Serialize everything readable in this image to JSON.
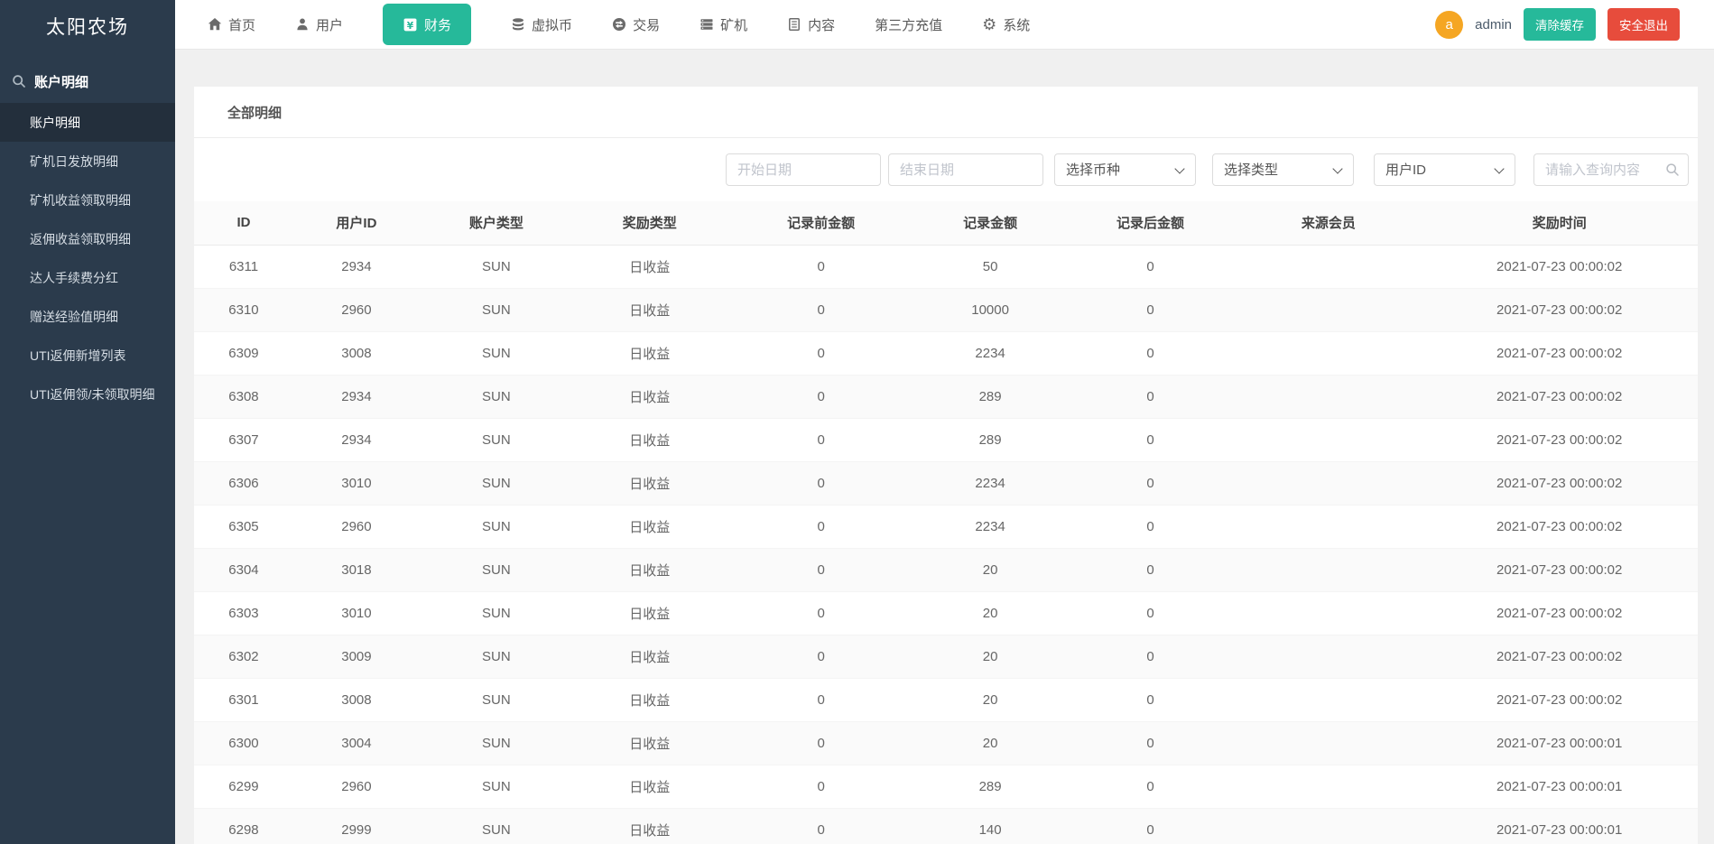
{
  "colors": {
    "green": "#26b99a",
    "red": "#e74c3c",
    "orange": "#f5a623",
    "sidebar_bg": "#2b3b4c"
  },
  "app": {
    "title": "太阳农场"
  },
  "topnav": {
    "items": [
      {
        "label": "首页",
        "icon": "home-icon"
      },
      {
        "label": "用户",
        "icon": "user-icon"
      },
      {
        "label": "财务",
        "icon": "finance-icon",
        "active": true
      },
      {
        "label": "虚拟币",
        "icon": "coins-icon"
      },
      {
        "label": "交易",
        "icon": "exchange-icon"
      },
      {
        "label": "矿机",
        "icon": "server-icon"
      },
      {
        "label": "内容",
        "icon": "content-icon"
      },
      {
        "label": "第三方充值",
        "icon": ""
      },
      {
        "label": "系统",
        "icon": "gear-icon"
      }
    ],
    "user": {
      "avatar_letter": "a",
      "name": "admin"
    },
    "clear_cache_label": "清除缓存",
    "logout_label": "安全退出"
  },
  "sidebar": {
    "section_title": "账户明细",
    "items": [
      {
        "label": "账户明细",
        "active": true
      },
      {
        "label": "矿机日发放明细"
      },
      {
        "label": "矿机收益领取明细"
      },
      {
        "label": "返佣收益领取明细"
      },
      {
        "label": "达人手续费分红"
      },
      {
        "label": "赠送经验值明细"
      },
      {
        "label": "UTI返佣新增列表"
      },
      {
        "label": "UTI返佣领/未领取明细"
      }
    ]
  },
  "panel": {
    "tab_label": "全部明细",
    "filters": {
      "start_date_placeholder": "开始日期",
      "end_date_placeholder": "结束日期",
      "coin_select_value": "选择币种",
      "type_select_value": "选择类型",
      "field_select_value": "用户ID",
      "search_placeholder": "请输入查询内容"
    },
    "table": {
      "columns": [
        "ID",
        "用户ID",
        "账户类型",
        "奖励类型",
        "记录前金额",
        "记录金额",
        "记录后金额",
        "来源会员",
        "奖励时间"
      ],
      "rows": [
        [
          "6311",
          "2934",
          "SUN",
          "日收益",
          "0",
          "50",
          "0",
          "",
          "2021-07-23 00:00:02"
        ],
        [
          "6310",
          "2960",
          "SUN",
          "日收益",
          "0",
          "10000",
          "0",
          "",
          "2021-07-23 00:00:02"
        ],
        [
          "6309",
          "3008",
          "SUN",
          "日收益",
          "0",
          "2234",
          "0",
          "",
          "2021-07-23 00:00:02"
        ],
        [
          "6308",
          "2934",
          "SUN",
          "日收益",
          "0",
          "289",
          "0",
          "",
          "2021-07-23 00:00:02"
        ],
        [
          "6307",
          "2934",
          "SUN",
          "日收益",
          "0",
          "289",
          "0",
          "",
          "2021-07-23 00:00:02"
        ],
        [
          "6306",
          "3010",
          "SUN",
          "日收益",
          "0",
          "2234",
          "0",
          "",
          "2021-07-23 00:00:02"
        ],
        [
          "6305",
          "2960",
          "SUN",
          "日收益",
          "0",
          "2234",
          "0",
          "",
          "2021-07-23 00:00:02"
        ],
        [
          "6304",
          "3018",
          "SUN",
          "日收益",
          "0",
          "20",
          "0",
          "",
          "2021-07-23 00:00:02"
        ],
        [
          "6303",
          "3010",
          "SUN",
          "日收益",
          "0",
          "20",
          "0",
          "",
          "2021-07-23 00:00:02"
        ],
        [
          "6302",
          "3009",
          "SUN",
          "日收益",
          "0",
          "20",
          "0",
          "",
          "2021-07-23 00:00:02"
        ],
        [
          "6301",
          "3008",
          "SUN",
          "日收益",
          "0",
          "20",
          "0",
          "",
          "2021-07-23 00:00:02"
        ],
        [
          "6300",
          "3004",
          "SUN",
          "日收益",
          "0",
          "20",
          "0",
          "",
          "2021-07-23 00:00:01"
        ],
        [
          "6299",
          "2960",
          "SUN",
          "日收益",
          "0",
          "289",
          "0",
          "",
          "2021-07-23 00:00:01"
        ],
        [
          "6298",
          "2999",
          "SUN",
          "日收益",
          "0",
          "140",
          "0",
          "",
          "2021-07-23 00:00:01"
        ]
      ]
    }
  }
}
